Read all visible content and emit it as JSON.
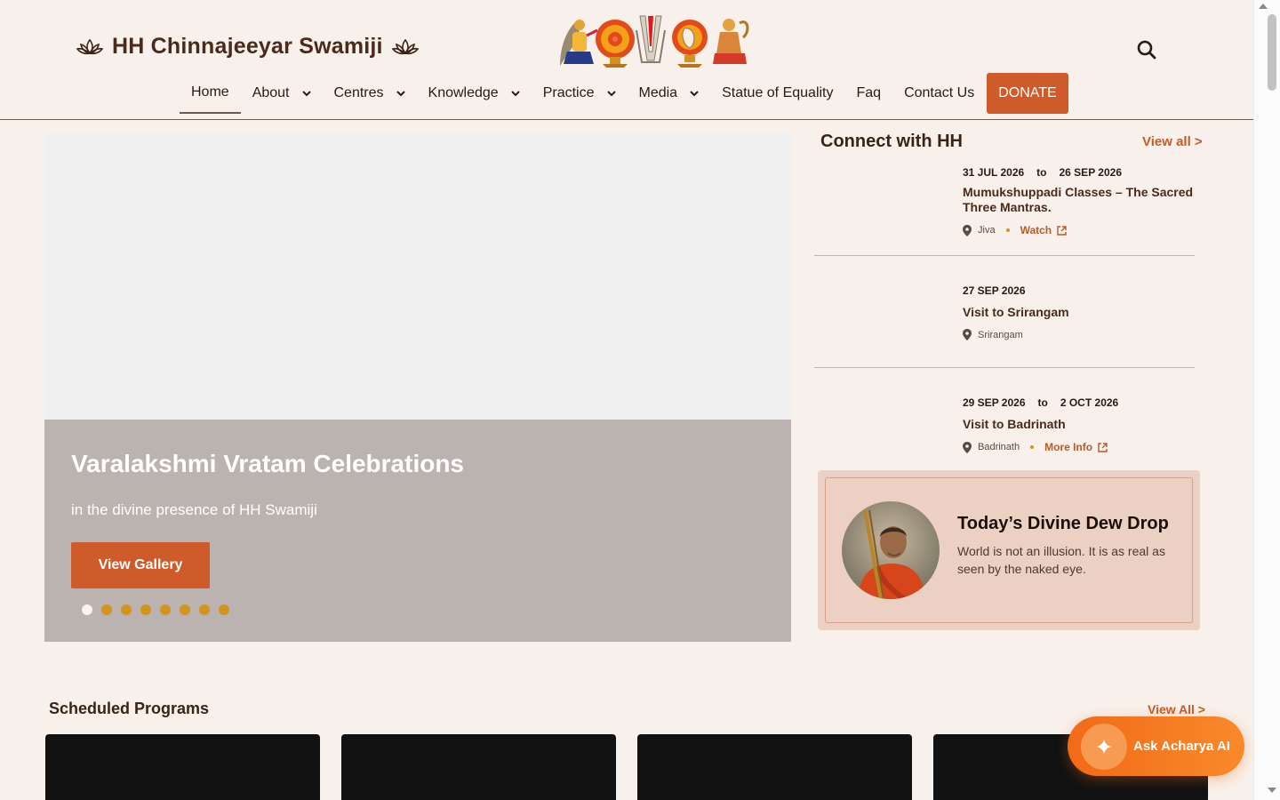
{
  "header": {
    "brand_title": "HH Chinnajeeyar Swamiji",
    "nav": [
      {
        "label": "Home",
        "active": true
      },
      {
        "label": "About",
        "dropdown": true
      },
      {
        "label": "Centres",
        "dropdown": true
      },
      {
        "label": "Knowledge",
        "dropdown": true
      },
      {
        "label": "Practice",
        "dropdown": true
      },
      {
        "label": "Media",
        "dropdown": true
      },
      {
        "label": "Statue of Equality"
      },
      {
        "label": "Faq"
      },
      {
        "label": "Contact Us"
      }
    ],
    "donate_label": "DONATE",
    "icons": [
      "lotus-icon",
      "search-icon"
    ]
  },
  "hero": {
    "title": "Varalakshmi Vratam Celebrations",
    "subtitle": "in the divine presence of HH Swamiji",
    "button_label": "View Gallery",
    "slide_count": 8,
    "active_slide": 0
  },
  "connect": {
    "title": "Connect with HH",
    "view_all": "View all >",
    "events": [
      {
        "start": "31 JUL 2026",
        "to": "to",
        "end": "26 SEP 2026",
        "title": "Mumukshuppadi Classes – The Sacred Three Mantras.",
        "location": "Jiva",
        "link": "Watch"
      },
      {
        "start": "27 SEP 2026",
        "title": "Visit to Srirangam",
        "location": "Srirangam"
      },
      {
        "start": "29 SEP 2026",
        "to": "to",
        "end": "2 OCT 2026",
        "title": "Visit to Badrinath",
        "location": "Badrinath",
        "link": "More Info"
      }
    ]
  },
  "dewdrop": {
    "title": "Today’s Divine Dew Drop",
    "text": "World is not an illusion. It is as real as seen by the naked eye."
  },
  "scheduled": {
    "title": "Scheduled Programs",
    "view_all": "View All >"
  },
  "ask": {
    "label": "Ask Acharya AI"
  },
  "colors": {
    "accent": "#cf5a2a",
    "background": "#f8f0ea",
    "gold": "#d4931c"
  }
}
